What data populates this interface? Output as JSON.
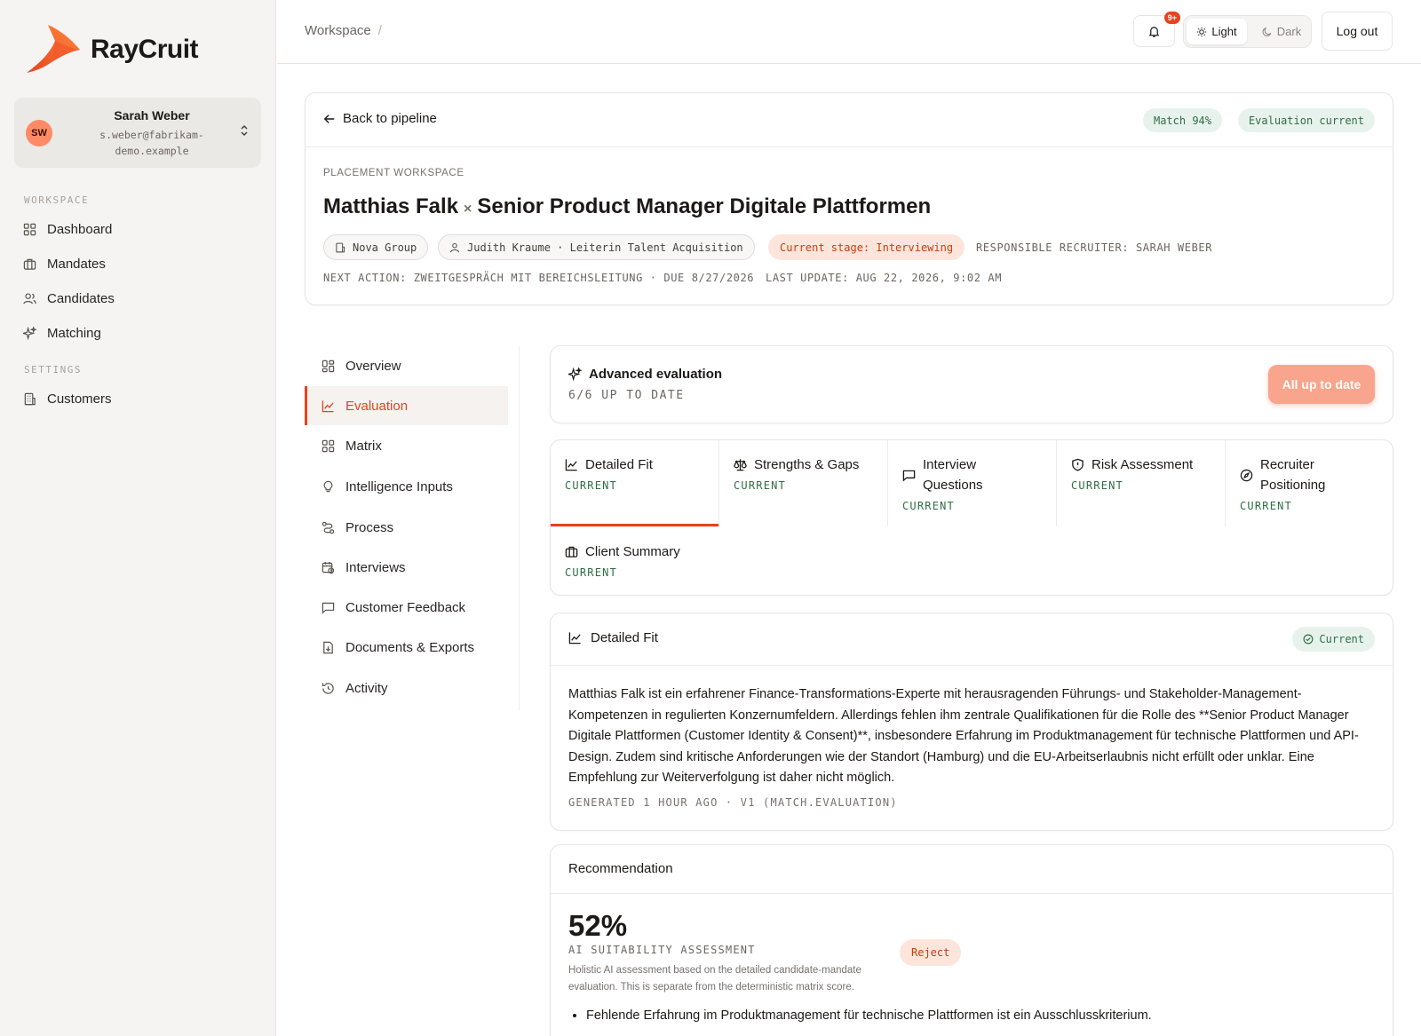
{
  "brand": {
    "name": "RayCruit",
    "accent": "#e8421f"
  },
  "user": {
    "initials": "SW",
    "name": "Sarah Weber",
    "email": "s.weber@fabrikam-demo.example"
  },
  "nav": {
    "workspace_label": "WORKSPACE",
    "items": [
      {
        "label": "Dashboard",
        "icon": "grid-icon"
      },
      {
        "label": "Mandates",
        "icon": "briefcase-icon"
      },
      {
        "label": "Candidates",
        "icon": "users-icon"
      },
      {
        "label": "Matching",
        "icon": "sparkles-icon"
      }
    ],
    "settings_label": "SETTINGS",
    "settings_items": [
      {
        "label": "Customers",
        "icon": "building-icon"
      }
    ]
  },
  "header": {
    "breadcrumb": "Workspace",
    "breadcrumb_sep": "/",
    "notifications_badge": "9+",
    "theme_light": "Light",
    "theme_dark": "Dark",
    "logout": "Log out"
  },
  "placement": {
    "back_label": "Back to pipeline",
    "match_badge": "Match 94%",
    "evaluation_badge": "Evaluation current",
    "eyebrow": "PLACEMENT WORKSPACE",
    "candidate": "Matthias Falk",
    "times": "×",
    "role": "Senior Product Manager Digitale Plattformen",
    "company": "Nova Group",
    "contact": "Judith Kraume · Leiterin Talent Acquisition",
    "stage": "Current stage: Interviewing",
    "recruiter": "RESPONSIBLE RECRUITER: SARAH WEBER",
    "next_action": "NEXT ACTION: ZWEITGESPRÄCH MIT BEREICHSLEITUNG · DUE 8/27/2026",
    "last_update": "LAST UPDATE: AUG 22, 2026, 9:02 AM"
  },
  "subnav": [
    {
      "label": "Overview",
      "icon": "layout-icon",
      "active": false
    },
    {
      "label": "Evaluation",
      "icon": "chart-line-icon",
      "active": true
    },
    {
      "label": "Matrix",
      "icon": "grid-icon",
      "active": false
    },
    {
      "label": "Intelligence Inputs",
      "icon": "lightbulb-icon",
      "active": false
    },
    {
      "label": "Process",
      "icon": "route-icon",
      "active": false
    },
    {
      "label": "Interviews",
      "icon": "calendar-clock-icon",
      "active": false
    },
    {
      "label": "Customer Feedback",
      "icon": "message-square-icon",
      "active": false
    },
    {
      "label": "Documents & Exports",
      "icon": "file-download-icon",
      "active": false
    },
    {
      "label": "Activity",
      "icon": "history-icon",
      "active": false
    }
  ],
  "advanced": {
    "title": "Advanced evaluation",
    "status": "6/6 UP TO DATE",
    "button": "All up to date"
  },
  "eval_tabs": [
    {
      "title": "Detailed Fit",
      "status": "CURRENT",
      "icon": "chart-line-icon",
      "active": true
    },
    {
      "title": "Strengths & Gaps",
      "status": "CURRENT",
      "icon": "scale-icon",
      "active": false
    },
    {
      "title": "Interview Questions",
      "status": "CURRENT",
      "icon": "message-square-icon",
      "active": false
    },
    {
      "title": "Risk Assessment",
      "status": "CURRENT",
      "icon": "shield-icon",
      "active": false
    },
    {
      "title": "Recruiter Positioning",
      "status": "CURRENT",
      "icon": "compass-icon",
      "active": false
    },
    {
      "title": "Client Summary",
      "status": "CURRENT",
      "icon": "briefcase-icon",
      "active": false
    }
  ],
  "detailed_fit": {
    "title": "Detailed Fit",
    "status": "Current",
    "body": "Matthias Falk ist ein erfahrener Finance-Transformations-Experte mit herausragenden Führungs- und Stakeholder-Management-Kompetenzen in regulierten Konzernumfeldern. Allerdings fehlen ihm zentrale Qualifikationen für die Rolle des **Senior Product Manager Digitale Plattformen (Customer Identity & Consent)**, insbesondere Erfahrung im Produktmanagement für technische Plattformen und API-Design. Zudem sind kritische Anforderungen wie der Standort (Hamburg) und die EU-Arbeitserlaubnis nicht erfüllt oder unklar. Eine Empfehlung zur Weiterverfolgung ist daher nicht möglich.",
    "footer": "GENERATED 1 HOUR AGO · V1 (MATCH.EVALUATION)"
  },
  "recommendation": {
    "title": "Recommendation",
    "score": "52%",
    "score_label": "AI SUITABILITY ASSESSMENT",
    "description": "Holistic AI assessment based on the detailed candidate-mandate evaluation. This is separate from the deterministic matrix score.",
    "verdict": "Reject",
    "points": [
      "Fehlende Erfahrung im Produktmanagement für technische Plattformen ist ein Ausschlusskriterium."
    ]
  }
}
